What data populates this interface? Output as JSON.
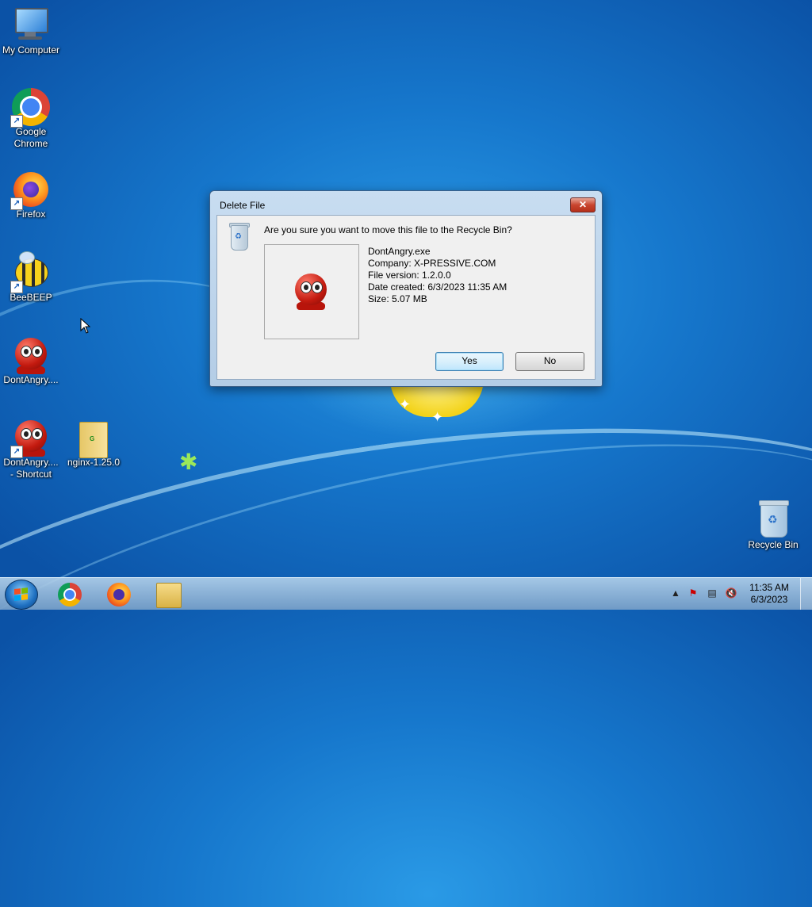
{
  "desktop": {
    "icons": [
      {
        "label": "My Computer"
      },
      {
        "label": "Google Chrome"
      },
      {
        "label": "Firefox"
      },
      {
        "label": "BeeBEEP"
      },
      {
        "label": "DontAngry...."
      },
      {
        "label": "DontAngry....\n- Shortcut"
      },
      {
        "label": "nginx-1.25.0"
      },
      {
        "label": "Recycle Bin"
      }
    ]
  },
  "dialog": {
    "title": "Delete File",
    "close_label": "✕",
    "question": "Are you sure you want to move this file to the Recycle Bin?",
    "file": {
      "name": "DontAngry.exe",
      "company": "Company: X-PRESSIVE.COM",
      "version": "File version: 1.2.0.0",
      "date_created": "Date created: 6/3/2023 11:35 AM",
      "size": "Size: 5.07 MB"
    },
    "yes_label": "Yes",
    "no_label": "No"
  },
  "taskbar": {
    "apps": [
      "chrome-icon",
      "firefox-icon",
      "explorer-folder-icon"
    ],
    "tray": {
      "show_hidden": "▲",
      "time": "11:35 AM",
      "date": "6/3/2023"
    }
  }
}
